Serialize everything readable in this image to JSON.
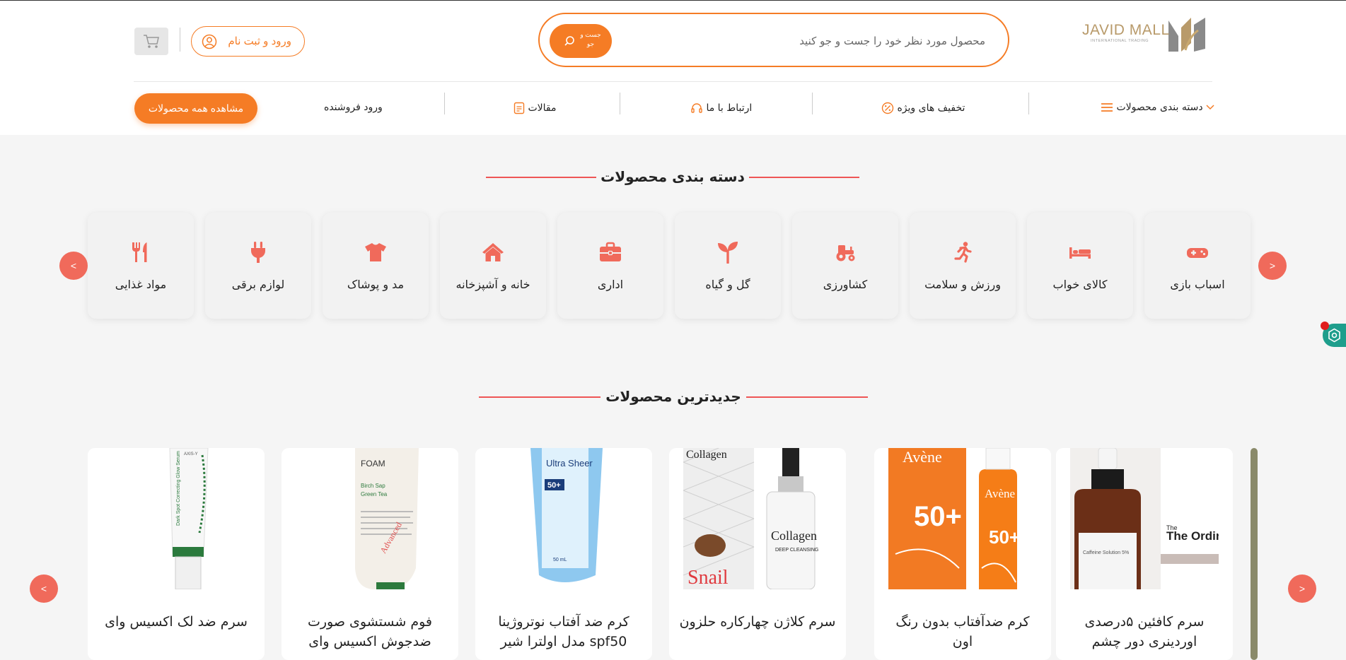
{
  "header": {
    "logo": {
      "name": "JAVID MALL",
      "tagline": "INTERNATIONAL TRADING"
    },
    "search": {
      "placeholder": "محصول مورد نظر خود را جست و جو کنید",
      "button_label": "جست و جو"
    },
    "login_label": "ورود و ثبت نام"
  },
  "nav": {
    "categories": "دسته بندی محصولات",
    "discounts": "تخفیف های ویژه",
    "contact": "ارتباط با ما",
    "articles": "مقالات",
    "seller_login": "ورود فروشنده",
    "view_all": "مشاهده همه محصولات"
  },
  "categories_section": {
    "title": "دسته بندی محصولات",
    "items": [
      {
        "label": "اسباب بازی",
        "icon": "gamepad-icon"
      },
      {
        "label": "کالای خواب",
        "icon": "bed-icon"
      },
      {
        "label": "ورزش و سلامت",
        "icon": "running-icon"
      },
      {
        "label": "کشاورزی",
        "icon": "tractor-icon"
      },
      {
        "label": "گل و گیاه",
        "icon": "seedling-icon"
      },
      {
        "label": "اداری",
        "icon": "briefcase-icon"
      },
      {
        "label": "خانه و آشپزخانه",
        "icon": "home-icon"
      },
      {
        "label": "مد و پوشاک",
        "icon": "tshirt-icon"
      },
      {
        "label": "لوازم برقی",
        "icon": "plug-icon"
      },
      {
        "label": "مواد غذایی",
        "icon": "utensils-icon"
      }
    ]
  },
  "products_section": {
    "title": "جدیدترین محصولات",
    "items": [
      {
        "name": "سرم کافئین ۵درصدی اوردینری دور چشم",
        "image_text": "The Ordinary."
      },
      {
        "name": "کرم ضدآفتاب بدون رنگ اون",
        "image_text": "Avène"
      },
      {
        "name": "سرم کلاژن چهارکاره حلزون",
        "image_text": "Collagen"
      },
      {
        "name": "کرم ضد آفتاب نوتروژینا spf50 مدل اولترا شیر",
        "image_text": "Ultra Sheer"
      },
      {
        "name": "فوم شستشوی صورت ضدجوش اکسیس وای",
        "image_text": "FOAM"
      },
      {
        "name": "سرم ضد لک اکسیس وای",
        "image_text": "AXIS-Y"
      }
    ]
  },
  "colors": {
    "accent": "#f57c25",
    "category_icon": "#f06a5b",
    "title_line": "#ee5555"
  }
}
